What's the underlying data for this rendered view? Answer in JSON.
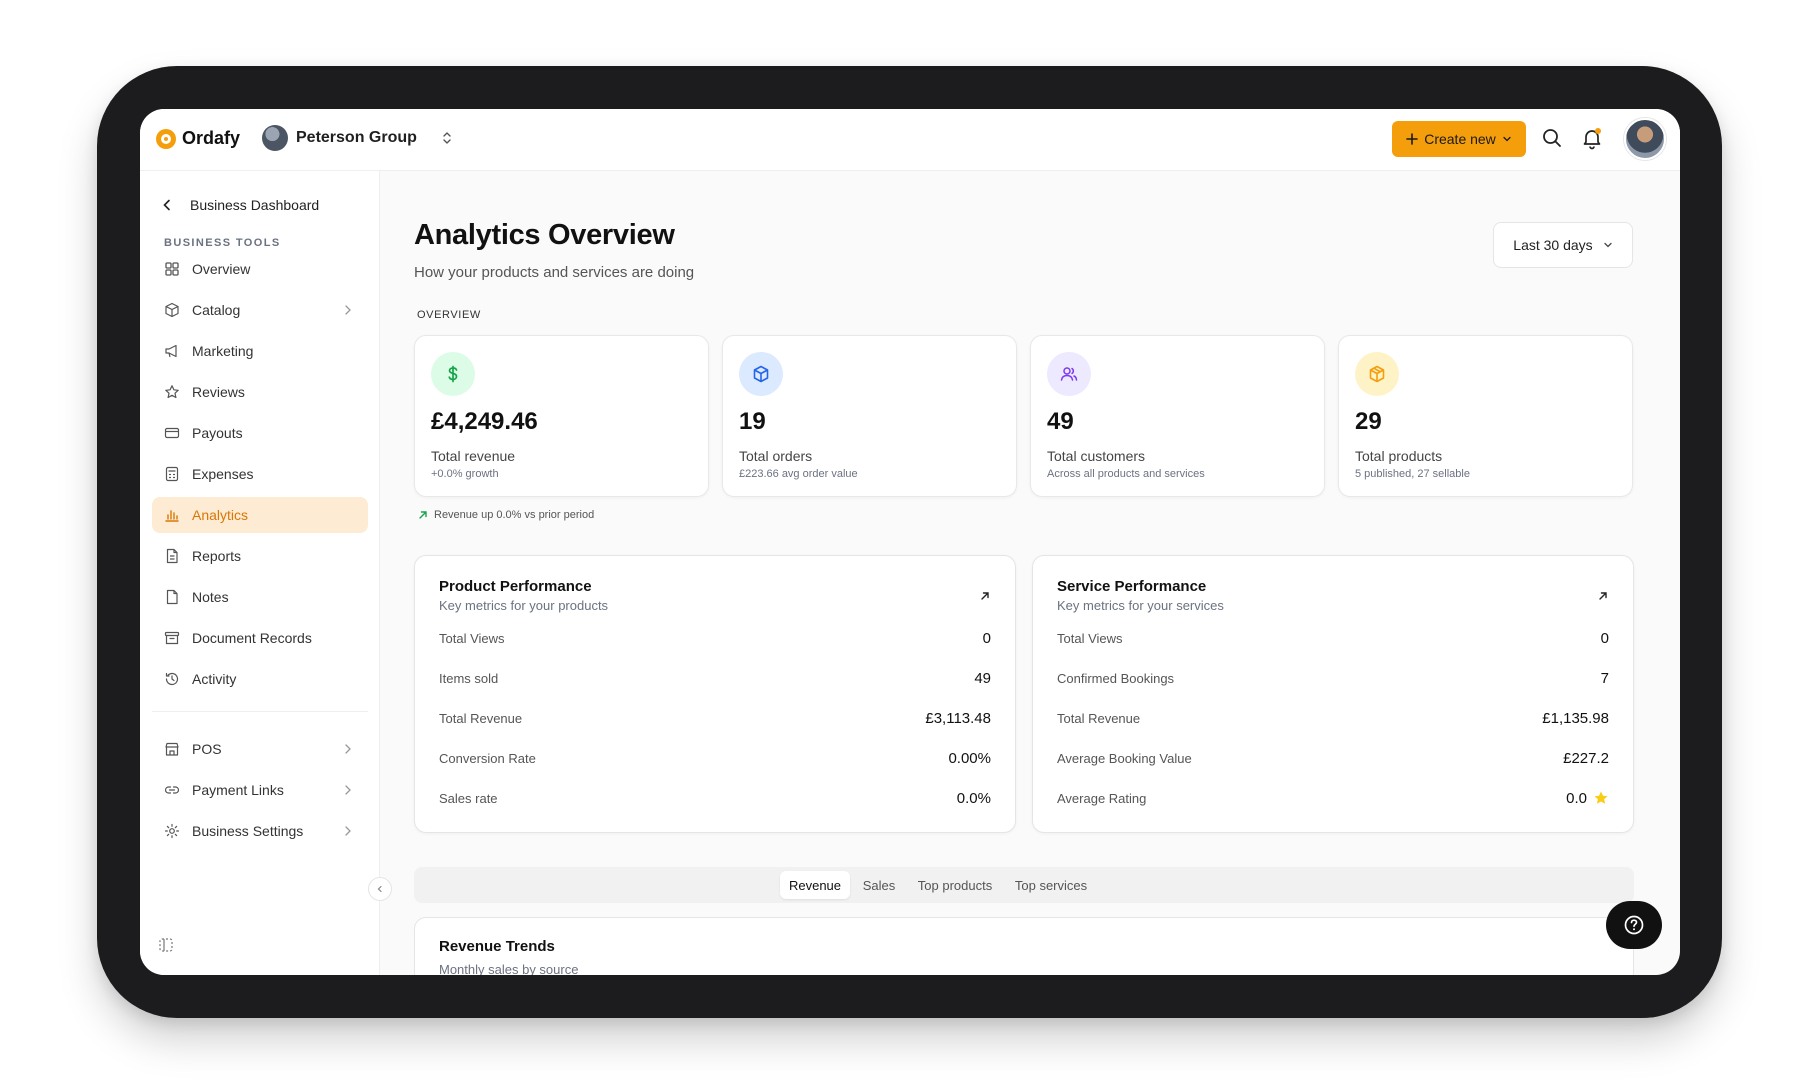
{
  "header": {
    "brand": "Ordafy",
    "organization": "Peterson Group",
    "create_label": "Create new"
  },
  "sidebar": {
    "back_label": "Business Dashboard",
    "section_label": "BUSINESS TOOLS",
    "items": [
      {
        "label": "Overview"
      },
      {
        "label": "Catalog"
      },
      {
        "label": "Marketing"
      },
      {
        "label": "Reviews"
      },
      {
        "label": "Payouts"
      },
      {
        "label": "Expenses"
      },
      {
        "label": "Analytics"
      },
      {
        "label": "Reports"
      },
      {
        "label": "Notes"
      },
      {
        "label": "Document Records"
      },
      {
        "label": "Activity"
      }
    ],
    "secondary_items": [
      {
        "label": "POS"
      },
      {
        "label": "Payment Links"
      },
      {
        "label": "Business Settings"
      }
    ],
    "active_item": "Analytics"
  },
  "page": {
    "title": "Analytics Overview",
    "subtitle": "How your products and services are doing",
    "date_range": "Last 30 days",
    "overview_label": "OVERVIEW"
  },
  "stats": [
    {
      "value": "£4,249.46",
      "label": "Total revenue",
      "note": "+0.0% growth",
      "icon": "dollar-icon",
      "color": "#16a34a",
      "bg": "#dcfce7"
    },
    {
      "value": "19",
      "label": "Total orders",
      "note": "£223.66 avg order value",
      "icon": "cube-icon",
      "color": "#2563eb",
      "bg": "#dbeafe"
    },
    {
      "value": "49",
      "label": "Total customers",
      "note": "Across all products and services",
      "icon": "users-icon",
      "color": "#7c3aed",
      "bg": "#ede9fe"
    },
    {
      "value": "29",
      "label": "Total products",
      "note": "5 published, 27 sellable",
      "icon": "package-icon",
      "color": "#f59e0b",
      "bg": "#fef3c7"
    }
  ],
  "trend_note": "Revenue up 0.0% vs prior period",
  "product_performance": {
    "title": "Product Performance",
    "subtitle": "Key metrics for your products",
    "rows": [
      {
        "label": "Total Views",
        "value": "0"
      },
      {
        "label": "Items sold",
        "value": "49"
      },
      {
        "label": "Total Revenue",
        "value": "£3,113.48"
      },
      {
        "label": "Conversion Rate",
        "value": "0.00%"
      },
      {
        "label": "Sales rate",
        "value": "0.0%"
      }
    ]
  },
  "service_performance": {
    "title": "Service Performance",
    "subtitle": "Key metrics for your services",
    "rows": [
      {
        "label": "Total Views",
        "value": "0"
      },
      {
        "label": "Confirmed Bookings",
        "value": "7"
      },
      {
        "label": "Total Revenue",
        "value": "£1,135.98"
      },
      {
        "label": "Average Booking Value",
        "value": "£227.2"
      },
      {
        "label": "Average Rating",
        "value": "0.0"
      }
    ]
  },
  "tabs": [
    {
      "label": "Revenue",
      "active": true
    },
    {
      "label": "Sales",
      "active": false
    },
    {
      "label": "Top products",
      "active": false
    },
    {
      "label": "Top services",
      "active": false
    }
  ],
  "revenue_trends": {
    "title": "Revenue Trends",
    "subtitle": "Monthly sales by source"
  },
  "colors": {
    "accent": "#f59e0b",
    "active_bg": "#fdebd3",
    "active_text": "#d97706"
  }
}
